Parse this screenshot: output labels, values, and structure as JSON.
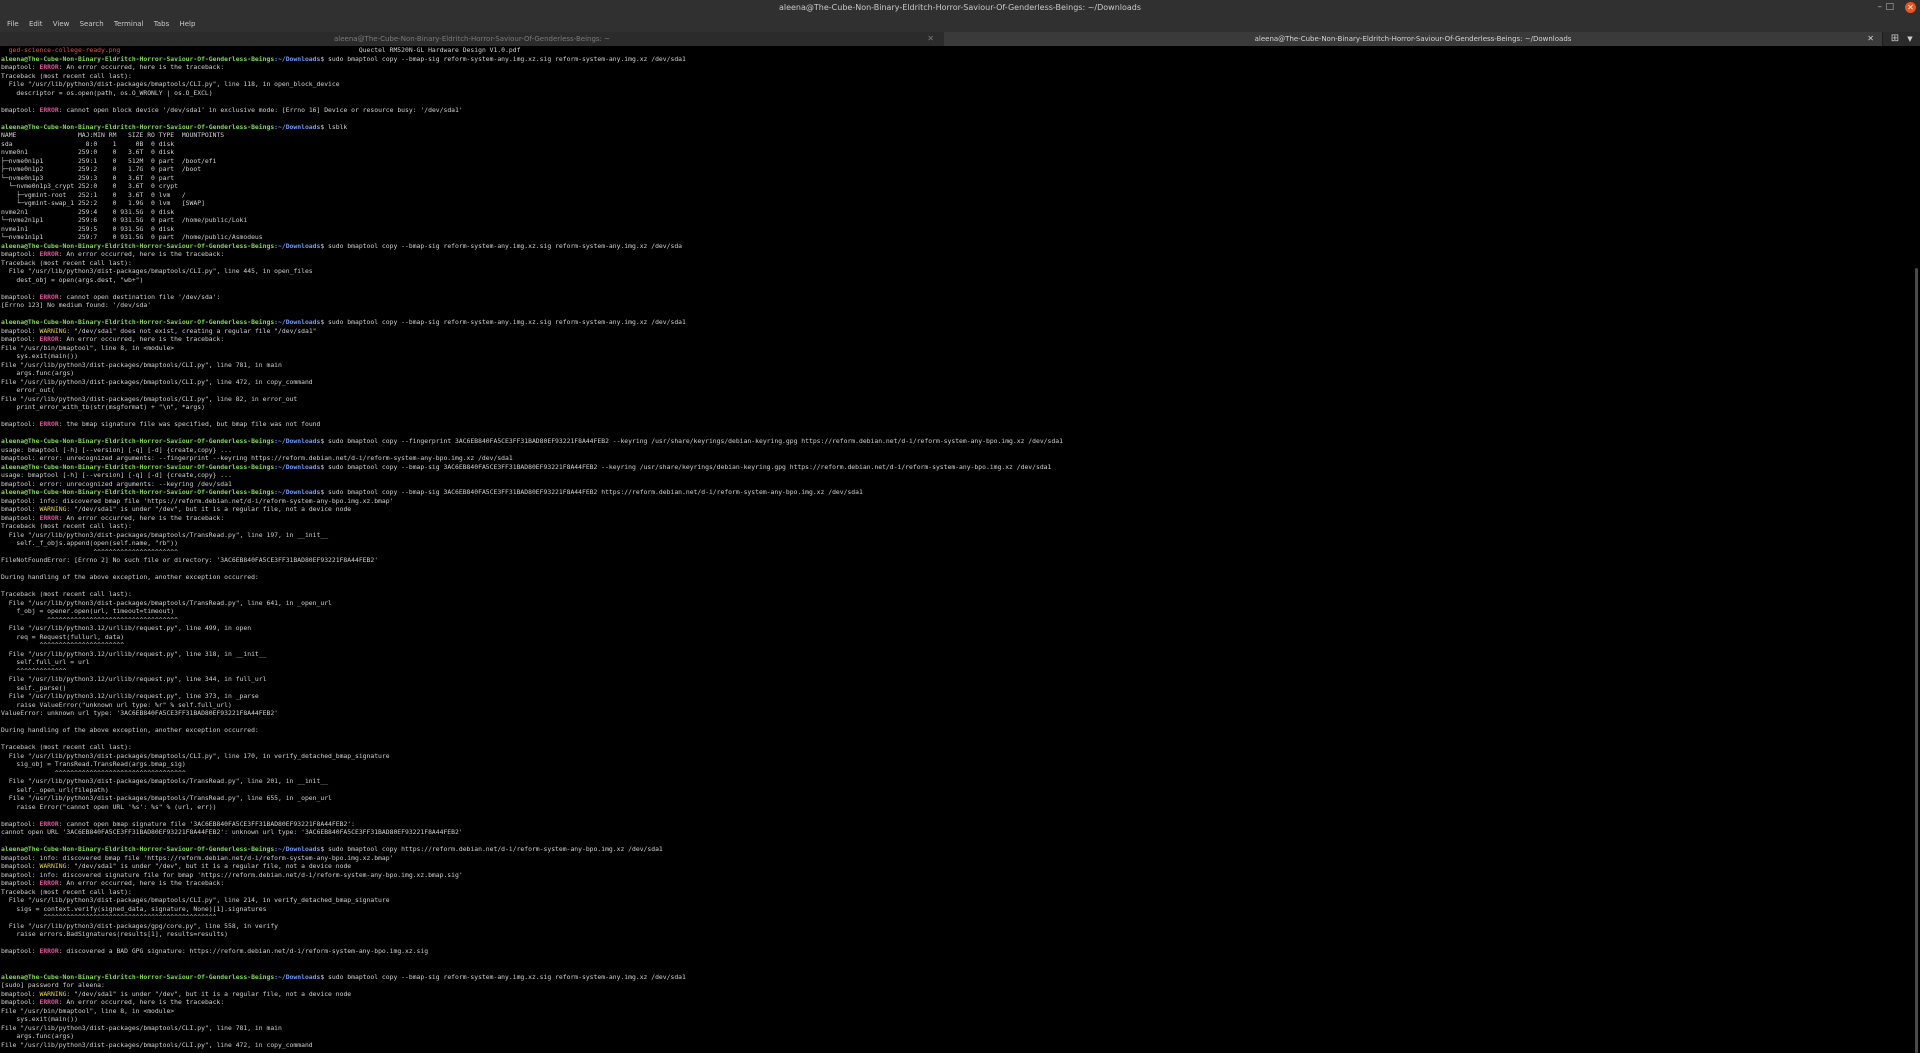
{
  "window": {
    "title": "aleena@The-Cube-Non-Binary-Eldritch-Horror-Saviour-Of-Genderless-Beings: ~/Downloads"
  },
  "menu": [
    "File",
    "Edit",
    "View",
    "Search",
    "Terminal",
    "Tabs",
    "Help"
  ],
  "tabs": [
    {
      "label": "aleena@The-Cube-Non-Binary-Eldritch-Horror-Saviour-Of-Genderless-Beings: ~",
      "active": false
    },
    {
      "label": "aleena@The-Cube-Non-Binary-Eldritch-Horror-Saviour-Of-Genderless-Beings: ~/Downloads",
      "active": true
    }
  ],
  "icons": {
    "close": "close-icon",
    "minimize": "minimize-icon",
    "maximize": "maximize-icon",
    "new_tab": "plus-icon",
    "tab_menu": "chevron-down-icon"
  },
  "colors": {
    "prompt_user": "#7ed957",
    "prompt_path": "#6f9bff",
    "error": "#e05252",
    "error_word": "#e0559e",
    "background": "#000000"
  },
  "prompt": {
    "user_host": "aleena@The-Cube-Non-Binary-Eldritch-Horror-Saviour-Of-Genderless-Beings",
    "path": ":~/Downloads",
    "symbol": "$ "
  },
  "lines": [
    {
      "segs": [
        [
          "  ged-science-college-ready.png",
          "red"
        ],
        [
          "                                                              Quectel RM520N-GL Hardware Design V1.0.pdf",
          ""
        ]
      ]
    },
    {
      "prompt": true,
      "cmd": "sudo bmaptool copy --bmap-sig reform-system-any.img.xz.sig reform-system-any.img.xz /dev/sda1"
    },
    {
      "segs": [
        [
          "bmaptool: ",
          ""
        ],
        [
          "ERROR",
          "magenta"
        ],
        [
          ": An error occurred, here is the traceback:",
          ""
        ]
      ]
    },
    {
      "segs": [
        [
          "Traceback (most recent call last):",
          ""
        ]
      ]
    },
    {
      "segs": [
        [
          "  File \"/usr/lib/python3/dist-packages/bmaptools/CLI.py\", line 118, in open_block_device",
          ""
        ]
      ]
    },
    {
      "segs": [
        [
          "    descriptor = os.open(path, os.O_WRONLY | os.O_EXCL)",
          ""
        ]
      ]
    },
    {
      "segs": [
        [
          "",
          ""
        ]
      ]
    },
    {
      "segs": [
        [
          "bmaptool: ",
          ""
        ],
        [
          "ERROR",
          "magenta"
        ],
        [
          ": cannot open block device '/dev/sda1' in exclusive mode: [Errno 16] Device or resource busy: '/dev/sda1'",
          ""
        ]
      ]
    },
    {
      "segs": [
        [
          "",
          ""
        ]
      ]
    },
    {
      "prompt": true,
      "cmd": "lsblk"
    },
    {
      "segs": [
        [
          "NAME                MAJ:MIN RM   SIZE RO TYPE  MOUNTPOINTS",
          ""
        ]
      ]
    },
    {
      "segs": [
        [
          "sda                   8:0    1     0B  0 disk",
          ""
        ]
      ]
    },
    {
      "segs": [
        [
          "nvme0n1             259:0    0   3.6T  0 disk",
          ""
        ]
      ]
    },
    {
      "segs": [
        [
          "├─nvme0n1p1         259:1    0   512M  0 part  /boot/efi",
          ""
        ]
      ]
    },
    {
      "segs": [
        [
          "├─nvme0n1p2         259:2    0   1.7G  0 part  /boot",
          ""
        ]
      ]
    },
    {
      "segs": [
        [
          "└─nvme0n1p3         259:3    0   3.6T  0 part",
          ""
        ]
      ]
    },
    {
      "segs": [
        [
          "  └─nvme0n1p3_crypt 252:0    0   3.6T  0 crypt",
          ""
        ]
      ]
    },
    {
      "segs": [
        [
          "    ├─vgmint-root   252:1    0   3.6T  0 lvm   /",
          ""
        ]
      ]
    },
    {
      "segs": [
        [
          "    └─vgmint-swap_1 252:2    0   1.9G  0 lvm   [SWAP]",
          ""
        ]
      ]
    },
    {
      "segs": [
        [
          "nvme2n1             259:4    0 931.5G  0 disk",
          ""
        ]
      ]
    },
    {
      "segs": [
        [
          "└─nvme2n1p1         259:6    0 931.5G  0 part  /home/public/Loki",
          ""
        ]
      ]
    },
    {
      "segs": [
        [
          "nvme1n1             259:5    0 931.5G  0 disk",
          ""
        ]
      ]
    },
    {
      "segs": [
        [
          "└─nvme1n1p1         259:7    0 931.5G  0 part  /home/public/Asmodeus",
          ""
        ]
      ]
    },
    {
      "prompt": true,
      "cmd": "sudo bmaptool copy --bmap-sig reform-system-any.img.xz.sig reform-system-any.img.xz /dev/sda"
    },
    {
      "segs": [
        [
          "bmaptool: ",
          ""
        ],
        [
          "ERROR",
          "magenta"
        ],
        [
          ": An error occurred, here is the traceback:",
          ""
        ]
      ]
    },
    {
      "segs": [
        [
          "Traceback (most recent call last):",
          ""
        ]
      ]
    },
    {
      "segs": [
        [
          "  File \"/usr/lib/python3/dist-packages/bmaptools/CLI.py\", line 445, in open_files",
          ""
        ]
      ]
    },
    {
      "segs": [
        [
          "    dest_obj = open(args.dest, \"wb+\")",
          ""
        ]
      ]
    },
    {
      "segs": [
        [
          "",
          ""
        ]
      ]
    },
    {
      "segs": [
        [
          "bmaptool: ",
          ""
        ],
        [
          "ERROR",
          "magenta"
        ],
        [
          ": cannot open destination file '/dev/sda':",
          ""
        ]
      ]
    },
    {
      "segs": [
        [
          "[Errno 123] No medium found: '/dev/sda'",
          ""
        ]
      ]
    },
    {
      "segs": [
        [
          "",
          ""
        ]
      ]
    },
    {
      "prompt": true,
      "cmd": "sudo bmaptool copy --bmap-sig reform-system-any.img.xz.sig reform-system-any.img.xz /dev/sda1"
    },
    {
      "segs": [
        [
          "bmaptool: ",
          ""
        ],
        [
          "WARNING",
          "yellow"
        ],
        [
          ": \"/dev/sda1\" does not exist, creating a regular file \"/dev/sda1\"",
          ""
        ]
      ]
    },
    {
      "segs": [
        [
          "bmaptool: ",
          ""
        ],
        [
          "ERROR",
          "magenta"
        ],
        [
          ": An error occurred, here is the traceback:",
          ""
        ]
      ]
    },
    {
      "segs": [
        [
          "File \"/usr/bin/bmaptool\", line 8, in <module>",
          ""
        ]
      ]
    },
    {
      "segs": [
        [
          "    sys.exit(main())",
          ""
        ]
      ]
    },
    {
      "segs": [
        [
          "File \"/usr/lib/python3/dist-packages/bmaptools/CLI.py\", line 781, in main",
          ""
        ]
      ]
    },
    {
      "segs": [
        [
          "    args.func(args)",
          ""
        ]
      ]
    },
    {
      "segs": [
        [
          "File \"/usr/lib/python3/dist-packages/bmaptools/CLI.py\", line 472, in copy_command",
          ""
        ]
      ]
    },
    {
      "segs": [
        [
          "    error_out(",
          ""
        ]
      ]
    },
    {
      "segs": [
        [
          "File \"/usr/lib/python3/dist-packages/bmaptools/CLI.py\", line 82, in error_out",
          ""
        ]
      ]
    },
    {
      "segs": [
        [
          "    print_error_with_tb(str(msgformat) + \"\\n\", *args)",
          ""
        ]
      ]
    },
    {
      "segs": [
        [
          "",
          ""
        ]
      ]
    },
    {
      "segs": [
        [
          "bmaptool: ",
          ""
        ],
        [
          "ERROR",
          "magenta"
        ],
        [
          ": the bmap signature file was specified, but bmap file was not found",
          ""
        ]
      ]
    },
    {
      "segs": [
        [
          "",
          ""
        ]
      ]
    },
    {
      "prompt": true,
      "cmd": "sudo bmaptool copy --fingerprint 3AC6EB840FA5CE3FF31BAD80EF93221F8A44FEB2 --keyring /usr/share/keyrings/debian-keyring.gpg https://reform.debian.net/d-i/reform-system-any-bpo.img.xz /dev/sda1"
    },
    {
      "segs": [
        [
          "usage: bmaptool [-h] [--version] [-q] [-d] {create,copy} ...",
          ""
        ]
      ]
    },
    {
      "segs": [
        [
          "bmaptool: error: unrecognized arguments: --fingerprint --keyring https://reform.debian.net/d-i/reform-system-any-bpo.img.xz /dev/sda1",
          ""
        ]
      ]
    },
    {
      "prompt": true,
      "cmd": "sudo bmaptool copy --bmap-sig 3AC6EB840FA5CE3FF31BAD80EF93221F8A44FEB2 --keyring /usr/share/keyrings/debian-keyring.gpg https://reform.debian.net/d-i/reform-system-any-bpo.img.xz /dev/sda1"
    },
    {
      "segs": [
        [
          "usage: bmaptool [-h] [--version] [-q] [-d] {create,copy} ...",
          ""
        ]
      ]
    },
    {
      "segs": [
        [
          "bmaptool: error: unrecognized arguments: --keyring /dev/sda1",
          ""
        ]
      ]
    },
    {
      "prompt": true,
      "cmd": "sudo bmaptool copy --bmap-sig 3AC6EB840FA5CE3FF31BAD80EF93221F8A44FEB2 https://reform.debian.net/d-i/reform-system-any-bpo.img.xz /dev/sda1"
    },
    {
      "segs": [
        [
          "bmaptool: info: discovered bmap file 'https://reform.debian.net/d-i/reform-system-any-bpo.img.xz.bmap'",
          ""
        ]
      ]
    },
    {
      "segs": [
        [
          "bmaptool: ",
          ""
        ],
        [
          "WARNING",
          "yellow"
        ],
        [
          ": \"/dev/sda1\" is under \"/dev\", but it is a regular file, not a device node",
          ""
        ]
      ]
    },
    {
      "segs": [
        [
          "bmaptool: ",
          ""
        ],
        [
          "ERROR",
          "magenta"
        ],
        [
          ": An error occurred, here is the traceback:",
          ""
        ]
      ]
    },
    {
      "segs": [
        [
          "Traceback (most recent call last):",
          ""
        ]
      ]
    },
    {
      "segs": [
        [
          "  File \"/usr/lib/python3/dist-packages/bmaptools/TransRead.py\", line 197, in __init__",
          ""
        ]
      ]
    },
    {
      "segs": [
        [
          "    self._f_objs.append(open(self.name, \"rb\"))",
          ""
        ]
      ]
    },
    {
      "segs": [
        [
          "                        ^^^^^^^^^^^^^^^^^^^^^^",
          ""
        ]
      ]
    },
    {
      "segs": [
        [
          "FileNotFoundError: [Errno 2] No such file or directory: '3AC6EB840FA5CE3FF31BAD80EF93221F8A44FEB2'",
          ""
        ]
      ]
    },
    {
      "segs": [
        [
          "",
          ""
        ]
      ]
    },
    {
      "segs": [
        [
          "During handling of the above exception, another exception occurred:",
          ""
        ]
      ]
    },
    {
      "segs": [
        [
          "",
          ""
        ]
      ]
    },
    {
      "segs": [
        [
          "Traceback (most recent call last):",
          ""
        ]
      ]
    },
    {
      "segs": [
        [
          "  File \"/usr/lib/python3/dist-packages/bmaptools/TransRead.py\", line 641, in _open_url",
          ""
        ]
      ]
    },
    {
      "segs": [
        [
          "    f_obj = opener.open(url, timeout=timeout)",
          ""
        ]
      ]
    },
    {
      "segs": [
        [
          "            ^^^^^^^^^^^^^^^^^^^^^^^^^^^^^^^^^^",
          ""
        ]
      ]
    },
    {
      "segs": [
        [
          "  File \"/usr/lib/python3.12/urllib/request.py\", line 499, in open",
          ""
        ]
      ]
    },
    {
      "segs": [
        [
          "    req = Request(fullurl, data)",
          ""
        ]
      ]
    },
    {
      "segs": [
        [
          "          ^^^^^^^^^^^^^^^^^^^^^^",
          ""
        ]
      ]
    },
    {
      "segs": [
        [
          "  File \"/usr/lib/python3.12/urllib/request.py\", line 318, in __init__",
          ""
        ]
      ]
    },
    {
      "segs": [
        [
          "    self.full_url = url",
          ""
        ]
      ]
    },
    {
      "segs": [
        [
          "    ^^^^^^^^^^^^^",
          ""
        ]
      ]
    },
    {
      "segs": [
        [
          "  File \"/usr/lib/python3.12/urllib/request.py\", line 344, in full_url",
          ""
        ]
      ]
    },
    {
      "segs": [
        [
          "    self._parse()",
          ""
        ]
      ]
    },
    {
      "segs": [
        [
          "  File \"/usr/lib/python3.12/urllib/request.py\", line 373, in _parse",
          ""
        ]
      ]
    },
    {
      "segs": [
        [
          "    raise ValueError(\"unknown url type: %r\" % self.full_url)",
          ""
        ]
      ]
    },
    {
      "segs": [
        [
          "ValueError: unknown url type: '3AC6EB840FA5CE3FF31BAD80EF93221F8A44FEB2'",
          ""
        ]
      ]
    },
    {
      "segs": [
        [
          "",
          ""
        ]
      ]
    },
    {
      "segs": [
        [
          "During handling of the above exception, another exception occurred:",
          ""
        ]
      ]
    },
    {
      "segs": [
        [
          "",
          ""
        ]
      ]
    },
    {
      "segs": [
        [
          "Traceback (most recent call last):",
          ""
        ]
      ]
    },
    {
      "segs": [
        [
          "  File \"/usr/lib/python3/dist-packages/bmaptools/CLI.py\", line 170, in verify_detached_bmap_signature",
          ""
        ]
      ]
    },
    {
      "segs": [
        [
          "    sig_obj = TransRead.TransRead(args.bmap_sig)",
          ""
        ]
      ]
    },
    {
      "segs": [
        [
          "              ^^^^^^^^^^^^^^^^^^^^^^^^^^^^^^^^^^",
          ""
        ]
      ]
    },
    {
      "segs": [
        [
          "  File \"/usr/lib/python3/dist-packages/bmaptools/TransRead.py\", line 201, in __init__",
          ""
        ]
      ]
    },
    {
      "segs": [
        [
          "    self._open_url(filepath)",
          ""
        ]
      ]
    },
    {
      "segs": [
        [
          "  File \"/usr/lib/python3/dist-packages/bmaptools/TransRead.py\", line 655, in _open_url",
          ""
        ]
      ]
    },
    {
      "segs": [
        [
          "    raise Error(\"cannot open URL '%s': %s\" % (url, err))",
          ""
        ]
      ]
    },
    {
      "segs": [
        [
          "",
          ""
        ]
      ]
    },
    {
      "segs": [
        [
          "bmaptool: ",
          ""
        ],
        [
          "ERROR",
          "magenta"
        ],
        [
          ": cannot open bmap signature file '3AC6EB840FA5CE3FF31BAD80EF93221F8A44FEB2':",
          ""
        ]
      ]
    },
    {
      "segs": [
        [
          "cannot open URL '3AC6EB840FA5CE3FF31BAD80EF93221F8A44FEB2': unknown url type: '3AC6EB840FA5CE3FF31BAD80EF93221F8A44FEB2'",
          ""
        ]
      ]
    },
    {
      "segs": [
        [
          "",
          ""
        ]
      ]
    },
    {
      "prompt": true,
      "cmd": "sudo bmaptool copy https://reform.debian.net/d-i/reform-system-any-bpo.img.xz /dev/sda1"
    },
    {
      "segs": [
        [
          "bmaptool: info: discovered bmap file 'https://reform.debian.net/d-i/reform-system-any-bpo.img.xz.bmap'",
          ""
        ]
      ]
    },
    {
      "segs": [
        [
          "bmaptool: ",
          ""
        ],
        [
          "WARNING",
          "yellow"
        ],
        [
          ": \"/dev/sda1\" is under \"/dev\", but it is a regular file, not a device node",
          ""
        ]
      ]
    },
    {
      "segs": [
        [
          "bmaptool: info: discovered signature file for bmap 'https://reform.debian.net/d-i/reform-system-any-bpo.img.xz.bmap.sig'",
          ""
        ]
      ]
    },
    {
      "segs": [
        [
          "bmaptool: ",
          ""
        ],
        [
          "ERROR",
          "magenta"
        ],
        [
          ": An error occurred, here is the traceback:",
          ""
        ]
      ]
    },
    {
      "segs": [
        [
          "Traceback (most recent call last):",
          ""
        ]
      ]
    },
    {
      "segs": [
        [
          "  File \"/usr/lib/python3/dist-packages/bmaptools/CLI.py\", line 214, in verify_detached_bmap_signature",
          ""
        ]
      ]
    },
    {
      "segs": [
        [
          "    sigs = context.verify(signed_data, signature, None)[1].signatures",
          ""
        ]
      ]
    },
    {
      "segs": [
        [
          "           ^^^^^^^^^^^^^^^^^^^^^^^^^^^^^^^^^^^^^^^^^^^^^",
          ""
        ]
      ]
    },
    {
      "segs": [
        [
          "  File \"/usr/lib/python3/dist-packages/gpg/core.py\", line 558, in verify",
          ""
        ]
      ]
    },
    {
      "segs": [
        [
          "    raise errors.BadSignatures(results[1], results=results)",
          ""
        ]
      ]
    },
    {
      "segs": [
        [
          "",
          ""
        ]
      ]
    },
    {
      "segs": [
        [
          "bmaptool: ",
          ""
        ],
        [
          "ERROR",
          "magenta"
        ],
        [
          ": discovered a BAD GPG signature: https://reform.debian.net/d-i/reform-system-any-bpo.img.xz.sig",
          ""
        ]
      ]
    },
    {
      "segs": [
        [
          "",
          ""
        ]
      ]
    },
    {
      "segs": [
        [
          "",
          ""
        ]
      ]
    },
    {
      "prompt": true,
      "cmd": "sudo bmaptool copy --bmap-sig reform-system-any.img.xz.sig reform-system-any.img.xz /dev/sda1"
    },
    {
      "segs": [
        [
          "[sudo] password for aleena:",
          ""
        ]
      ]
    },
    {
      "segs": [
        [
          "bmaptool: ",
          ""
        ],
        [
          "WARNING",
          "yellow"
        ],
        [
          ": \"/dev/sda1\" is under \"/dev\", but it is a regular file, not a device node",
          ""
        ]
      ]
    },
    {
      "segs": [
        [
          "bmaptool: ",
          ""
        ],
        [
          "ERROR",
          "magenta"
        ],
        [
          ": An error occurred, here is the traceback:",
          ""
        ]
      ]
    },
    {
      "segs": [
        [
          "File \"/usr/bin/bmaptool\", line 8, in <module>",
          ""
        ]
      ]
    },
    {
      "segs": [
        [
          "    sys.exit(main())",
          ""
        ]
      ]
    },
    {
      "segs": [
        [
          "File \"/usr/lib/python3/dist-packages/bmaptools/CLI.py\", line 781, in main",
          ""
        ]
      ]
    },
    {
      "segs": [
        [
          "    args.func(args)",
          ""
        ]
      ]
    },
    {
      "segs": [
        [
          "File \"/usr/lib/python3/dist-packages/bmaptools/CLI.py\", line 472, in copy_command",
          ""
        ]
      ]
    }
  ]
}
